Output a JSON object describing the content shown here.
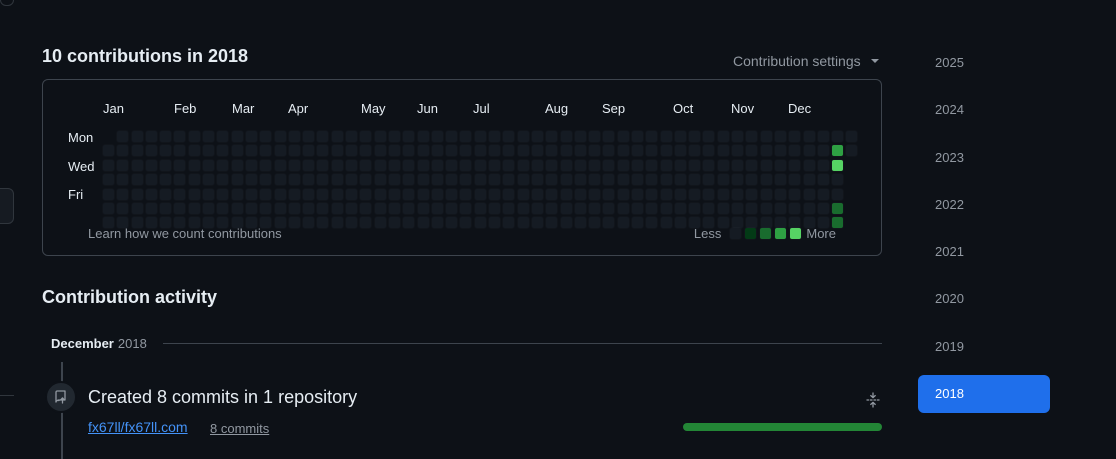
{
  "header": {
    "title": "10 contributions in 2018",
    "settings_label": "Contribution settings"
  },
  "graph": {
    "months": [
      "Jan",
      "Feb",
      "Mar",
      "Apr",
      "May",
      "Jun",
      "Jul",
      "Aug",
      "Sep",
      "Oct",
      "Nov",
      "Dec"
    ],
    "days": [
      "Mon",
      "Wed",
      "Fri"
    ],
    "learn_label": "Learn how we count contributions",
    "less_label": "Less",
    "more_label": "More",
    "weeks": 53,
    "first_week_start_row": 1,
    "last_week_end_row": 1,
    "contributions": [
      {
        "week": 51,
        "row": 1,
        "level": 3
      },
      {
        "week": 51,
        "row": 2,
        "level": 4
      },
      {
        "week": 51,
        "row": 5,
        "level": 2
      },
      {
        "week": 51,
        "row": 6,
        "level": 2
      }
    ],
    "colors": {
      "level0": "#151b23",
      "level1": "#033a16",
      "level2": "#196c2e",
      "level3": "#2ea043",
      "level4": "#56d364"
    }
  },
  "activity": {
    "title": "Contribution activity",
    "month": "December",
    "year": "2018",
    "event_title": "Created 8 commits in 1 repository",
    "repo": "fx67ll/fx67ll.com",
    "commits": "8 commits",
    "bar_color": "#238636",
    "bar_fraction": 1.0
  },
  "years": {
    "items": [
      "2025",
      "2024",
      "2023",
      "2022",
      "2021",
      "2020",
      "2019",
      "2018"
    ],
    "selected": "2018",
    "accent": "#1f6feb"
  }
}
